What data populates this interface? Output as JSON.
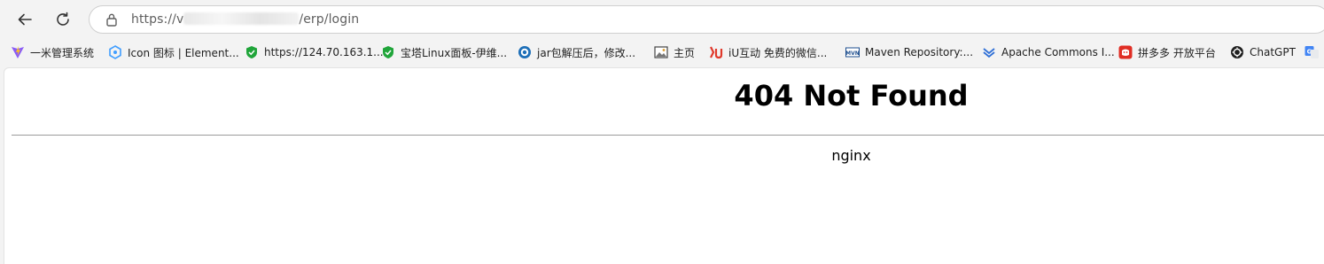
{
  "browser": {
    "url_prefix": "https://v",
    "url_suffix": "/erp/login"
  },
  "bookmarks": [
    {
      "label": "一米管理系统",
      "icon": "vite-icon"
    },
    {
      "label": "Icon 图标 | Element...",
      "icon": "element-icon"
    },
    {
      "label": "https://124.70.163.1...",
      "icon": "shield-icon"
    },
    {
      "label": "宝塔Linux面板-伊维...",
      "icon": "shield-icon"
    },
    {
      "label": "jar包解压后，修改...",
      "icon": "circle-logo-icon"
    },
    {
      "label": "主页",
      "icon": "image-icon"
    },
    {
      "label": "iU互动 免费的微信...",
      "icon": "iu-icon"
    },
    {
      "label": "Maven Repository:...",
      "icon": "mvn-icon"
    },
    {
      "label": "Apache Commons I...",
      "icon": "apache-icon"
    },
    {
      "label": "拼多多 开放平台",
      "icon": "pdd-icon"
    },
    {
      "label": "ChatGPT",
      "icon": "chatgpt-icon"
    }
  ],
  "page": {
    "title": "404 Not Found",
    "server": "nginx"
  },
  "colors": {
    "chrome_bg": "#f3f3f3",
    "text": "#000000"
  }
}
